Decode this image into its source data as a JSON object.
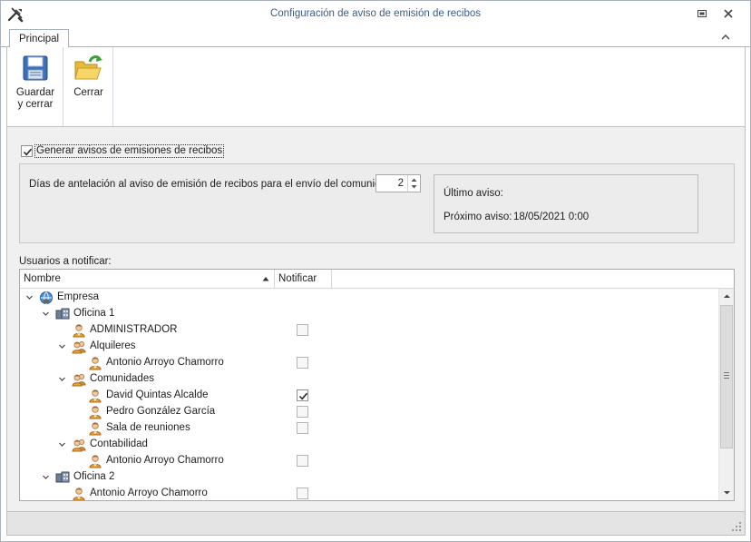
{
  "window": {
    "title": "Configuración de aviso de emisión de recibos"
  },
  "ribbon": {
    "tabs": [
      {
        "label": "Principal"
      }
    ],
    "buttons": {
      "save": {
        "line1": "Guardar",
        "line2": "y cerrar",
        "icon": "floppy-disk-icon"
      },
      "close": {
        "label": "Cerrar",
        "icon": "open-folder-icon"
      }
    }
  },
  "settings": {
    "generate_label": "Generar avisos de emisiones de recibos",
    "generate_checked": true,
    "days_label": "Días de antelación al aviso de emisión de recibos para el envío del comunicado:",
    "days_value": "2",
    "last_notice_label": "Último aviso:",
    "next_notice_label": "Próximo aviso:",
    "next_notice_value": "18/05/2021 0:00"
  },
  "users": {
    "label": "Usuarios a notificar:",
    "columns": {
      "name": "Nombre",
      "notify": "Notificar"
    },
    "rows": [
      {
        "name": "Empresa",
        "type": "company",
        "checked": null
      },
      {
        "name": "Oficina 1",
        "type": "office",
        "checked": null
      },
      {
        "name": "ADMINISTRADOR",
        "type": "user",
        "checked": false
      },
      {
        "name": "Alquileres",
        "type": "group",
        "checked": null
      },
      {
        "name": "Antonio Arroyo Chamorro",
        "type": "user",
        "checked": false
      },
      {
        "name": "Comunidades",
        "type": "group",
        "checked": null
      },
      {
        "name": "David Quintas Alcalde",
        "type": "user",
        "checked": true
      },
      {
        "name": "Pedro González García",
        "type": "user",
        "checked": false
      },
      {
        "name": "Sala de reuniones",
        "type": "user",
        "checked": false
      },
      {
        "name": "Contabilidad",
        "type": "group",
        "checked": null
      },
      {
        "name": "Antonio Arroyo Chamorro",
        "type": "user",
        "checked": false
      },
      {
        "name": "Oficina 2",
        "type": "office",
        "checked": null
      },
      {
        "name": "Antonio Arroyo Chamorro",
        "type": "user",
        "checked": false
      }
    ]
  }
}
